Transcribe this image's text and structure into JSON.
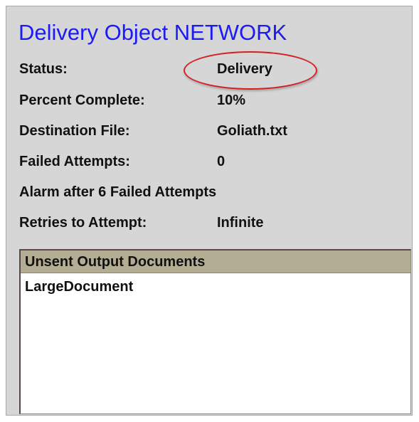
{
  "title": "Delivery Object NETWORK",
  "fields": [
    {
      "label": "Status:",
      "value": "Delivery"
    },
    {
      "label": "Percent Complete:",
      "value": "10%"
    },
    {
      "label": "Destination File:",
      "value": "Goliath.txt"
    },
    {
      "label": "Failed Attempts:",
      "value": "0"
    },
    {
      "label": "Alarm after 6 Failed Attempts",
      "value": ""
    },
    {
      "label": "Retries to Attempt:",
      "value": "Infinite"
    }
  ],
  "unsent_list": {
    "header": "Unsent Output Documents",
    "items": [
      "LargeDocument"
    ]
  },
  "colors": {
    "title": "#1c1cf2",
    "highlight_circle": "#d42020",
    "list_header_bg": "#b3ad94",
    "panel_bg": "#d6d6d6"
  }
}
